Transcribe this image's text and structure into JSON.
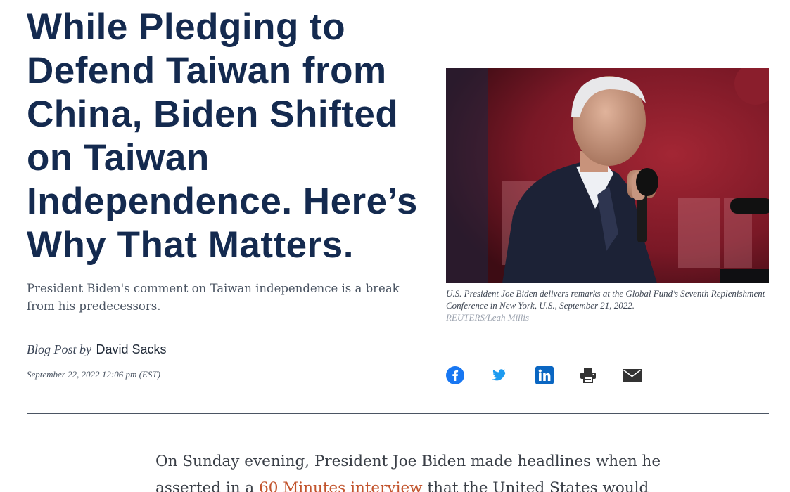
{
  "article": {
    "headline": "While Pledging to Defend Taiwan from China, Biden Shifted on Taiwan Independence. Here’s Why That Matters.",
    "dek": "President Biden's comment on Taiwan independence is a break from his predecessors.",
    "byline": {
      "type": "Blog Post",
      "by": "by",
      "author": "David Sacks"
    },
    "date": "September 22, 2022 12:06 pm (EST)"
  },
  "image": {
    "caption": "U.S. President Joe Biden delivers remarks at the Global Fund’s Seventh Replenishment Conference in New York, U.S., September 21, 2022.",
    "credit": "REUTERS/Leah Millis"
  },
  "share": [
    {
      "icon": "facebook-icon",
      "color": "#1877f2"
    },
    {
      "icon": "twitter-icon",
      "color": "#1d9bf0"
    },
    {
      "icon": "linkedin-icon",
      "color": "#0a66c2"
    },
    {
      "icon": "print-icon",
      "color": "#333333"
    },
    {
      "icon": "email-icon",
      "color": "#333333"
    }
  ],
  "body": {
    "line1": "On Sunday evening, President Joe Biden made headlines when he",
    "line2_pre": "asserted in a ",
    "line2_link": "60 Minutes interview",
    "line2_post": " that the United States would"
  },
  "colors": {
    "headline": "#142a4f",
    "link": "#c2542d",
    "hero_background": "#6b1620"
  }
}
